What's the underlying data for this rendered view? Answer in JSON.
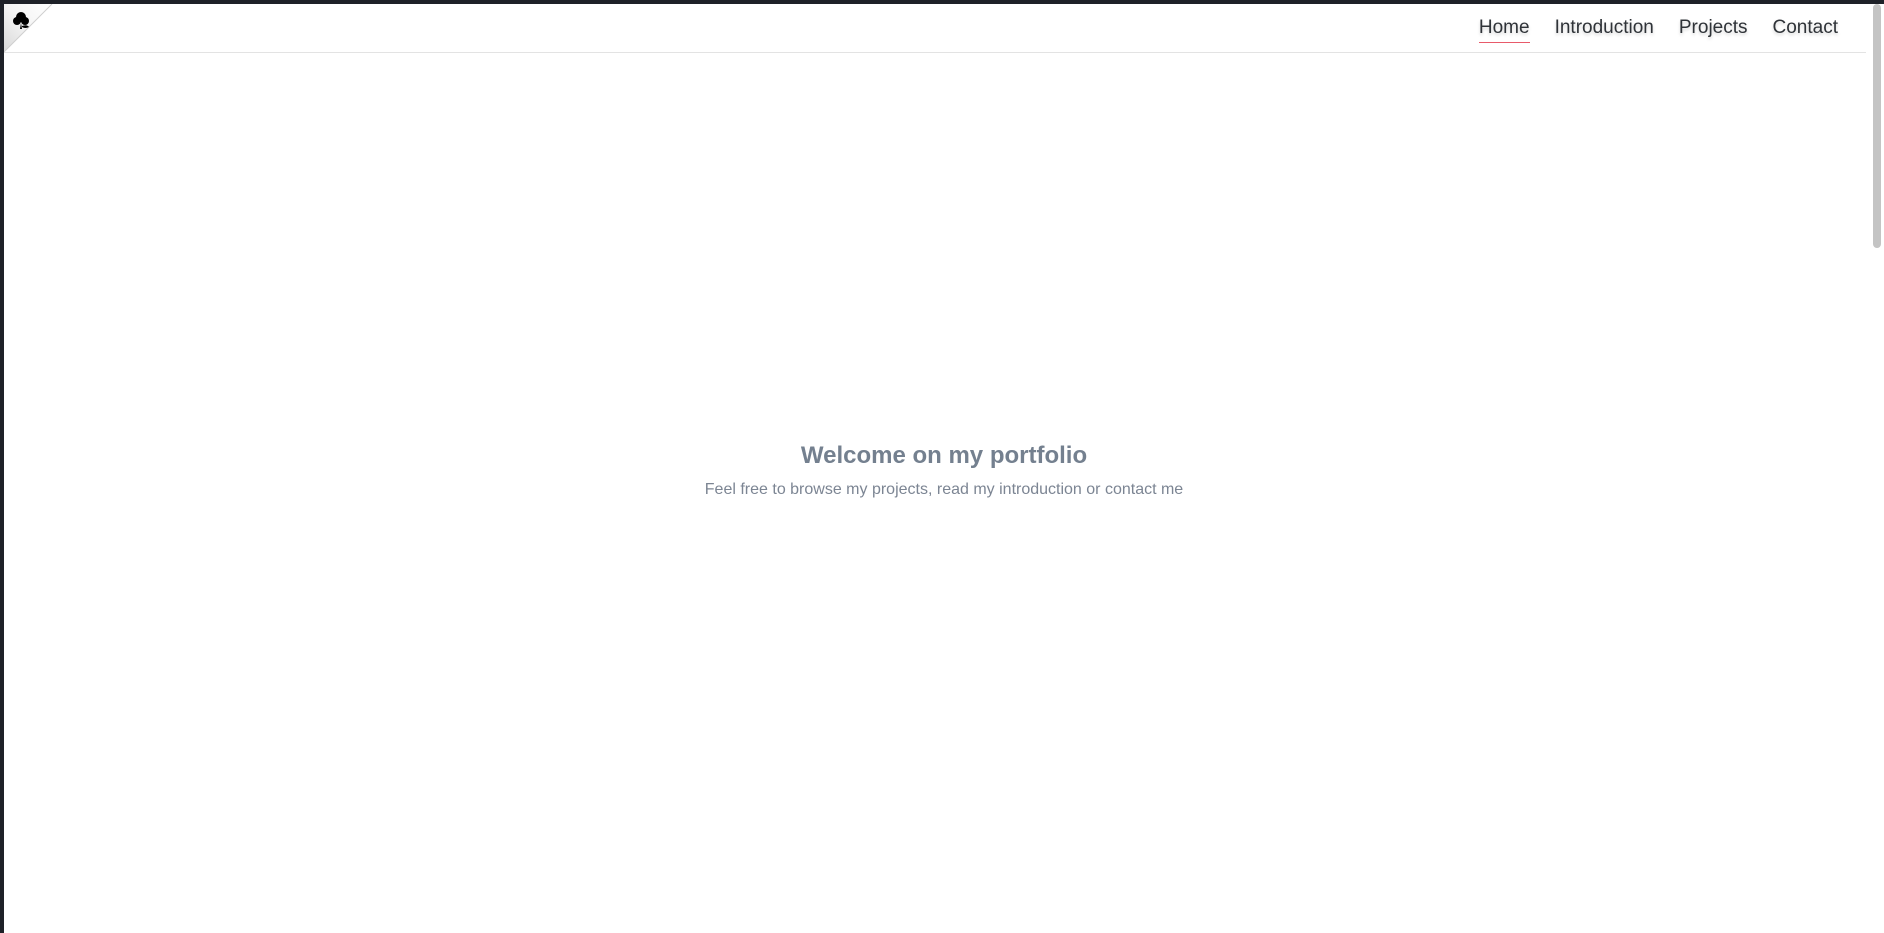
{
  "nav": {
    "links": [
      {
        "label": "Home",
        "active": true
      },
      {
        "label": "Introduction",
        "active": false
      },
      {
        "label": "Projects",
        "active": false
      },
      {
        "label": "Contact",
        "active": false
      }
    ],
    "logo_icon": "rose-icon"
  },
  "hero": {
    "title": "Welcome on my portfolio",
    "subtitle": "Feel free to browse my projects, read my introduction or contact me"
  },
  "colors": {
    "active_underline": "#e85a6a",
    "hero_title": "#74808f",
    "hero_subtitle": "#7c8593",
    "nav_text": "#2f3338"
  }
}
